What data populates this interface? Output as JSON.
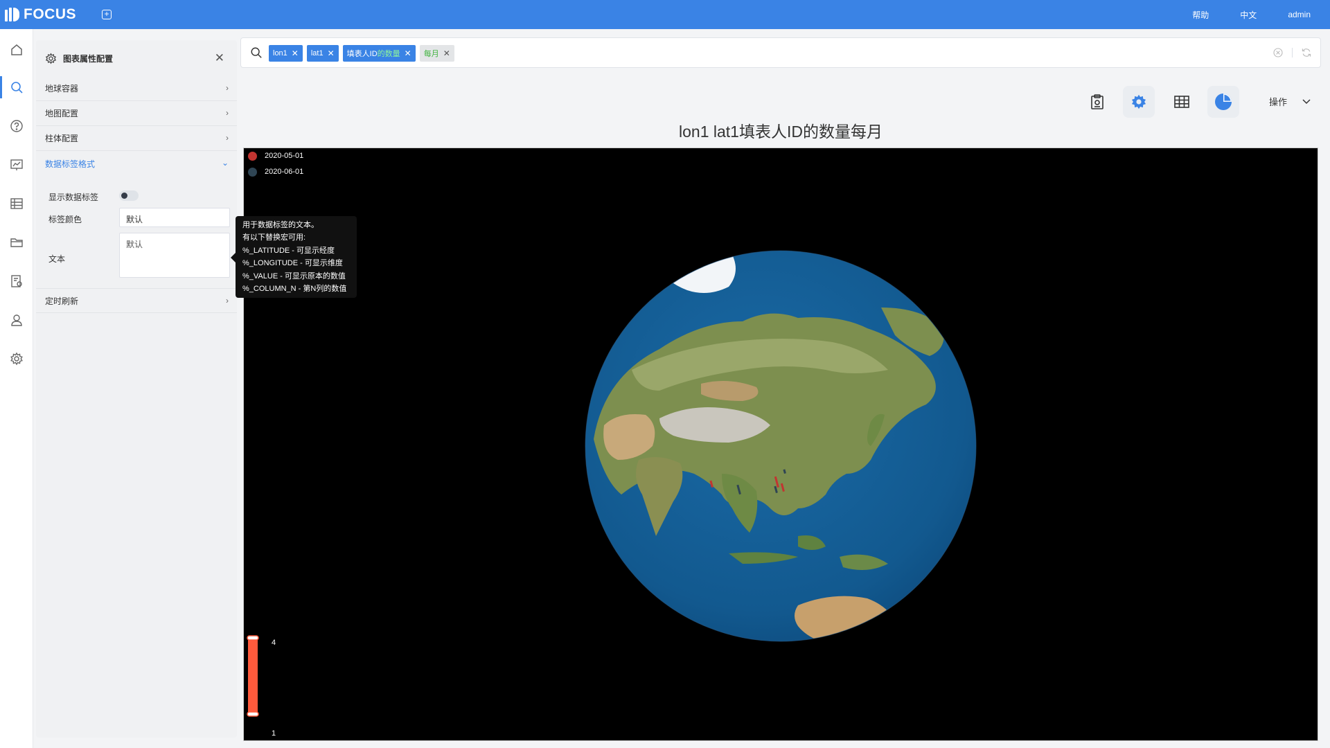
{
  "app": {
    "name": "FOCUS"
  },
  "topbar": {
    "help": "帮助",
    "lang": "中文",
    "user": "admin"
  },
  "panel": {
    "title": "图表属性配置",
    "sections": [
      {
        "label": "地球容器"
      },
      {
        "label": "地图配置"
      },
      {
        "label": "柱体配置"
      },
      {
        "label": "数据标签格式",
        "open": true
      },
      {
        "label": "定时刷新"
      }
    ],
    "show_label": "显示数据标签",
    "show_label_on": false,
    "label_color": "标签颜色",
    "label_color_value": "默认",
    "text_label": "文本",
    "text_value": "默认"
  },
  "tooltip": {
    "lines": [
      "用于数据标签的文本。",
      "有以下替换宏可用:",
      "%_LATITUDE - 可显示经度",
      "%_LONGITUDE - 可显示维度",
      "%_VALUE - 可显示原本的数值",
      "%_COLUMN_N - 第N列的数值"
    ]
  },
  "search": {
    "chips": [
      {
        "text": "lon1",
        "style": "blue"
      },
      {
        "text": "lat1",
        "style": "blue"
      },
      {
        "text": "填表人ID",
        "sub": "的数量",
        "style": "blue"
      },
      {
        "text": "每月",
        "style": "green"
      }
    ]
  },
  "toolbar": {
    "ops_label": "操作"
  },
  "chart": {
    "title": "lon1 lat1填表人ID的数量每月",
    "legend": [
      {
        "name": "2020-05-01",
        "color": "#c23531"
      },
      {
        "name": "2020-06-01",
        "color": "#2f4554"
      }
    ],
    "visual_map": {
      "max": "4",
      "min": "1",
      "color": "#ff5a3c"
    }
  },
  "chart_data": {
    "type": "3d-globe-bar",
    "title": "lon1 lat1填表人ID的数量每月",
    "series": [
      {
        "name": "2020-05-01",
        "color": "#c23531"
      },
      {
        "name": "2020-06-01",
        "color": "#2f4554"
      }
    ],
    "visual_map_range": [
      1,
      4
    ],
    "legend_position": "top-left"
  }
}
